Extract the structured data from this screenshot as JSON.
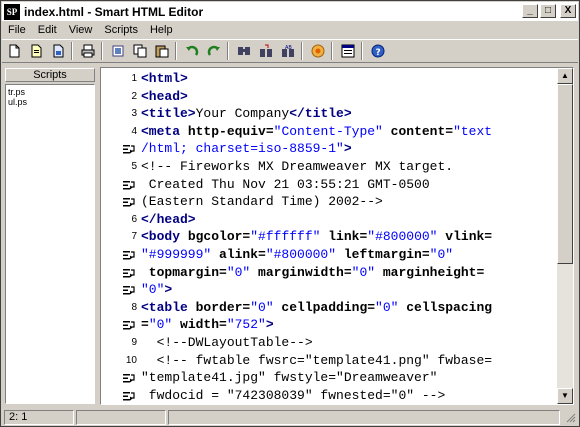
{
  "window": {
    "title": "index.html - Smart HTML Editor",
    "app_icon_text": "SP",
    "minimize": "_",
    "maximize": "□",
    "close": "X"
  },
  "menu": [
    "File",
    "Edit",
    "View",
    "Scripts",
    "Help"
  ],
  "toolbar_icons": [
    "new-document-icon",
    "open-document-icon",
    "save-document-icon",
    "print-icon",
    "cut-icon",
    "copy-icon",
    "paste-icon",
    "undo-icon",
    "redo-icon",
    "find-icon",
    "find-next-icon",
    "replace-icon",
    "preview-browser-icon",
    "properties-icon",
    "help-icon"
  ],
  "scripts": {
    "header": "Scripts",
    "items": [
      "tr.ps",
      "ul.ps"
    ]
  },
  "editor": {
    "lines": [
      {
        "num": "1",
        "wrap": false,
        "parts": [
          [
            "tag",
            "<html>"
          ]
        ]
      },
      {
        "num": "2",
        "wrap": false,
        "parts": [
          [
            "tag",
            "<head>"
          ]
        ]
      },
      {
        "num": "3",
        "wrap": false,
        "parts": [
          [
            "tag",
            "<title>"
          ],
          [
            "txt",
            "Your Company"
          ],
          [
            "tag",
            "</title>"
          ]
        ]
      },
      {
        "num": "4",
        "wrap": false,
        "parts": [
          [
            "tag",
            "<meta "
          ],
          [
            "attr",
            "http-equiv="
          ],
          [
            "val",
            "\"Content-Type\""
          ],
          [
            "attr",
            " content="
          ],
          [
            "val",
            "\"text"
          ]
        ]
      },
      {
        "num": "",
        "wrap": true,
        "parts": [
          [
            "val",
            "/html; charset=iso-8859-1\""
          ],
          [
            "tag",
            ">"
          ]
        ]
      },
      {
        "num": "5",
        "wrap": false,
        "parts": [
          [
            "cmt",
            "<!-- Fireworks MX Dreamweaver MX target."
          ]
        ]
      },
      {
        "num": "",
        "wrap": true,
        "parts": [
          [
            "cmt",
            " Created Thu Nov 21 03:55:21 GMT-0500"
          ]
        ]
      },
      {
        "num": "",
        "wrap": true,
        "parts": [
          [
            "cmt",
            "(Eastern Standard Time) 2002-->"
          ]
        ]
      },
      {
        "num": "6",
        "wrap": false,
        "parts": [
          [
            "tag",
            "</head>"
          ]
        ]
      },
      {
        "num": "7",
        "wrap": false,
        "parts": [
          [
            "tag",
            "<body "
          ],
          [
            "attr",
            "bgcolor="
          ],
          [
            "val",
            "\"#ffffff\""
          ],
          [
            "attr",
            " link="
          ],
          [
            "val",
            "\"#800000\""
          ],
          [
            "attr",
            " vlink="
          ]
        ]
      },
      {
        "num": "",
        "wrap": true,
        "parts": [
          [
            "val",
            "\"#999999\""
          ],
          [
            "attr",
            " alink="
          ],
          [
            "val",
            "\"#800000\""
          ],
          [
            "attr",
            " leftmargin="
          ],
          [
            "val",
            "\"0\""
          ]
        ]
      },
      {
        "num": "",
        "wrap": true,
        "parts": [
          [
            "attr",
            " topmargin="
          ],
          [
            "val",
            "\"0\""
          ],
          [
            "attr",
            " marginwidth="
          ],
          [
            "val",
            "\"0\""
          ],
          [
            "attr",
            " marginheight="
          ]
        ]
      },
      {
        "num": "",
        "wrap": true,
        "parts": [
          [
            "val",
            "\"0\""
          ],
          [
            "tag",
            ">"
          ]
        ]
      },
      {
        "num": "8",
        "wrap": false,
        "parts": [
          [
            "tag",
            "<table "
          ],
          [
            "attr",
            "border="
          ],
          [
            "val",
            "\"0\""
          ],
          [
            "attr",
            " cellpadding="
          ],
          [
            "val",
            "\"0\""
          ],
          [
            "attr",
            " cellspacing"
          ]
        ]
      },
      {
        "num": "",
        "wrap": true,
        "parts": [
          [
            "attr",
            "="
          ],
          [
            "val",
            "\"0\""
          ],
          [
            "attr",
            " width="
          ],
          [
            "val",
            "\"752\""
          ],
          [
            "tag",
            ">"
          ]
        ]
      },
      {
        "num": "9",
        "wrap": false,
        "parts": [
          [
            "cmt",
            "  <!--DWLayoutTable-->"
          ]
        ]
      },
      {
        "num": "10",
        "wrap": false,
        "parts": [
          [
            "cmt",
            "  <!-- fwtable fwsrc=\"template41.png\" fwbase="
          ]
        ]
      },
      {
        "num": "",
        "wrap": true,
        "parts": [
          [
            "cmt",
            "\"template41.jpg\" fwstyle=\"Dreamweaver\""
          ]
        ]
      },
      {
        "num": "",
        "wrap": true,
        "parts": [
          [
            "cmt",
            " fwdocid = \"742308039\" fwnested=\"0\" -->"
          ]
        ]
      }
    ]
  },
  "status": {
    "position": "2:  1",
    "cell2": "",
    "cell3": ""
  }
}
